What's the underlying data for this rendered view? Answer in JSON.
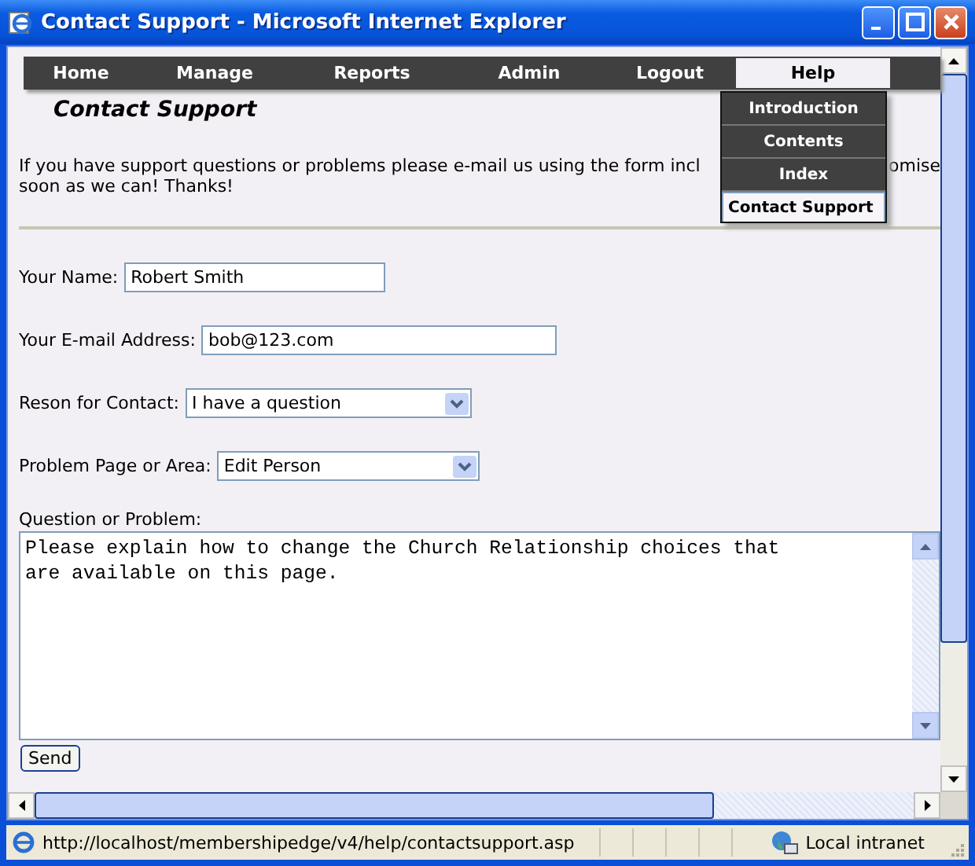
{
  "window": {
    "title": "Contact Support - Microsoft Internet Explorer"
  },
  "menu": {
    "items": [
      {
        "label": "Home",
        "open": false
      },
      {
        "label": "Manage",
        "open": false
      },
      {
        "label": "Reports",
        "open": false
      },
      {
        "label": "Admin",
        "open": false
      },
      {
        "label": "Logout",
        "open": false
      },
      {
        "label": "Help",
        "open": true
      }
    ],
    "dropdown": [
      {
        "label": "Introduction",
        "selected": false
      },
      {
        "label": "Contents",
        "selected": false
      },
      {
        "label": "Index",
        "selected": false
      },
      {
        "label": "Contact Support",
        "selected": true
      }
    ]
  },
  "heading": "Contact Support",
  "intro": {
    "line_1_start": "If you have support questions or problems please e-mail us using the form incl",
    "line_1_end": "omise",
    "line_2": "soon as we can! Thanks!"
  },
  "form": {
    "fields": [
      {
        "kind": "text",
        "label": "Your Name:",
        "value": "Robert Smith"
      },
      {
        "kind": "text",
        "label": "Your E-mail Address:",
        "value": "bob@123.com"
      },
      {
        "kind": "select",
        "label": "Reson for Contact:",
        "value": "I have a question"
      },
      {
        "kind": "select",
        "label": "Problem Page or Area:",
        "value": "Edit Person"
      },
      {
        "kind": "textarea",
        "label": "Question or Problem:",
        "value": "Please explain how to change the Church Relationship choices that\nare available on this page."
      }
    ],
    "submit": "Send"
  },
  "status_bar": {
    "url": "http://localhost/membershipedge/v4/help/contactsupport.asp",
    "zone": "Local intranet"
  }
}
